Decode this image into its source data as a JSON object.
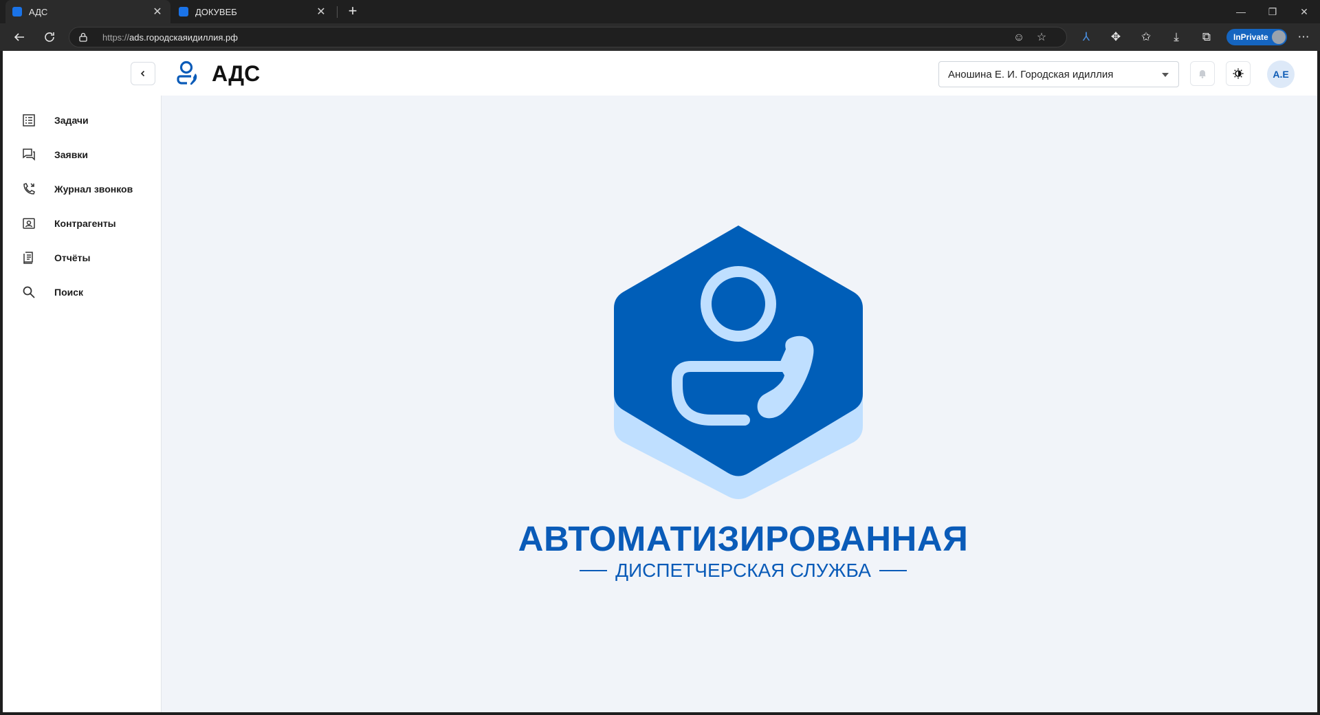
{
  "browser": {
    "tabs": [
      {
        "title": "АДС",
        "active": true
      },
      {
        "title": "ДОКУВЕБ",
        "active": false
      }
    ],
    "url_protocol": "https://",
    "url_host": "ads.городскаяидиллия.рф",
    "inprivate_label": "InPrivate"
  },
  "app": {
    "title": "АДС",
    "org_select_value": "Аношина Е. И. Городская идиллия",
    "user_initials": "А.Е"
  },
  "sidebar": {
    "items": [
      {
        "label": "Задачи",
        "icon": "task-list-icon"
      },
      {
        "label": "Заявки",
        "icon": "chat-requests-icon"
      },
      {
        "label": "Журнал звонков",
        "icon": "phone-log-icon"
      },
      {
        "label": "Контрагенты",
        "icon": "contact-card-icon"
      },
      {
        "label": "Отчёты",
        "icon": "report-icon"
      },
      {
        "label": "Поиск",
        "icon": "search-icon"
      }
    ]
  },
  "hero": {
    "title": "АВТОМАТИЗИРОВАННАЯ",
    "subtitle": "ДИСПЕТЧЕРСКАЯ СЛУЖБА"
  },
  "colors": {
    "brand_blue": "#005EB8",
    "brand_light": "#BFDFFF",
    "page_bg": "#F1F4F9"
  }
}
